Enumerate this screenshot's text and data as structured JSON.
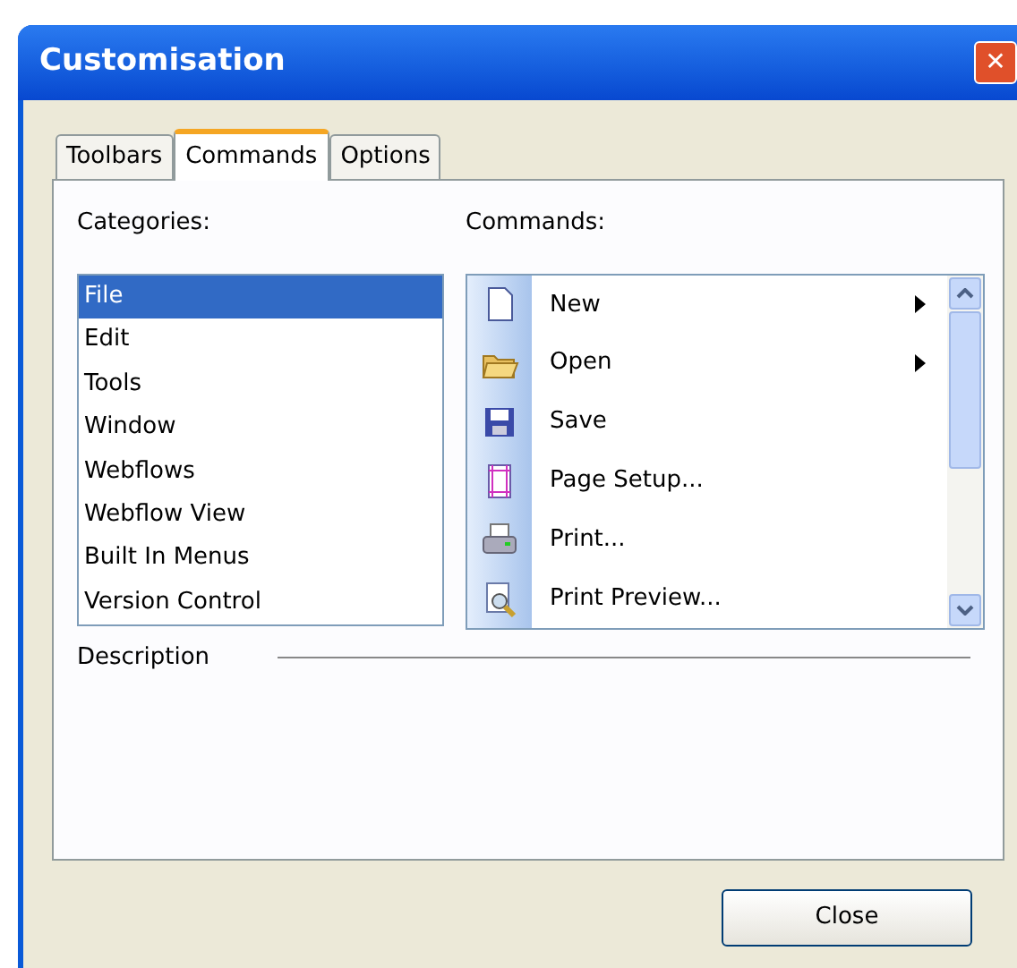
{
  "window": {
    "title": "Customisation",
    "close_glyph": "✕"
  },
  "tabs": [
    {
      "label": "Toolbars",
      "selected": false
    },
    {
      "label": "Commands",
      "selected": true
    },
    {
      "label": "Options",
      "selected": false
    }
  ],
  "categories": {
    "label": "Categories:",
    "items": [
      {
        "label": "File",
        "selected": true
      },
      {
        "label": "Edit",
        "selected": false
      },
      {
        "label": "Tools",
        "selected": false
      },
      {
        "label": "Window",
        "selected": false
      },
      {
        "label": "Webflows",
        "selected": false
      },
      {
        "label": "Webflow View",
        "selected": false
      },
      {
        "label": "Built In Menus",
        "selected": false
      },
      {
        "label": "Version Control",
        "selected": false
      }
    ]
  },
  "commands": {
    "label": "Commands:",
    "items": [
      {
        "kind": "page",
        "label": "New",
        "submenu": true
      },
      {
        "kind": "folder",
        "label": "Open",
        "submenu": true
      },
      {
        "kind": "disk",
        "label": "Save",
        "submenu": false
      },
      {
        "kind": "frame",
        "label": "Page Setup...",
        "submenu": false
      },
      {
        "kind": "printer",
        "label": "Print...",
        "submenu": false
      },
      {
        "kind": "magnifier",
        "label": "Print Preview...",
        "submenu": false
      }
    ]
  },
  "description": {
    "label": "Description"
  },
  "buttons": [
    {
      "label": "Close"
    }
  ]
}
